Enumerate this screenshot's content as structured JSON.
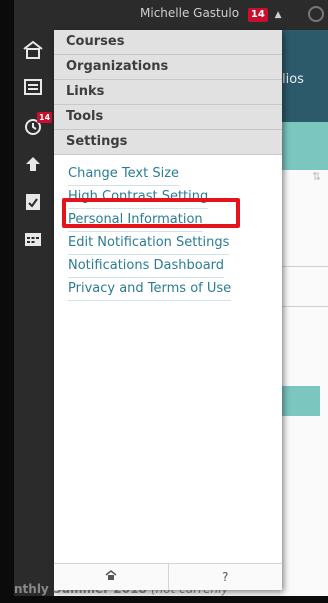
{
  "topbar": {
    "user_name": "Michelle Gastulo",
    "notification_count": "14"
  },
  "rail": {
    "alerts_badge": "14",
    "icons": [
      "home-icon",
      "courses-list-icon",
      "alerts-clock-icon",
      "upload-icon",
      "grades-icon",
      "calendar-icon"
    ]
  },
  "background": {
    "header_text": "lios",
    "bottom_text": "nthly Summer 2018",
    "bottom_text_note": "(not currenly"
  },
  "menu": {
    "items": [
      {
        "label": "Courses"
      },
      {
        "label": "Organizations"
      },
      {
        "label": "Links"
      },
      {
        "label": "Tools"
      },
      {
        "label": "Settings"
      }
    ]
  },
  "settings": {
    "links": [
      {
        "label": "Change Text Size"
      },
      {
        "label": "High Contrast Setting"
      },
      {
        "label": "Personal Information"
      },
      {
        "label": "Edit Notification Settings"
      },
      {
        "label": "Notifications Dashboard"
      },
      {
        "label": "Privacy and Terms of Use"
      }
    ],
    "highlighted": "Personal Information"
  },
  "footer": {
    "home_icon": "home-icon",
    "help_label": "?"
  },
  "colors": {
    "link": "#2b7c94",
    "highlight": "#e5141b",
    "badge": "#c8102e",
    "menu_bg": "#e1e1e1"
  }
}
